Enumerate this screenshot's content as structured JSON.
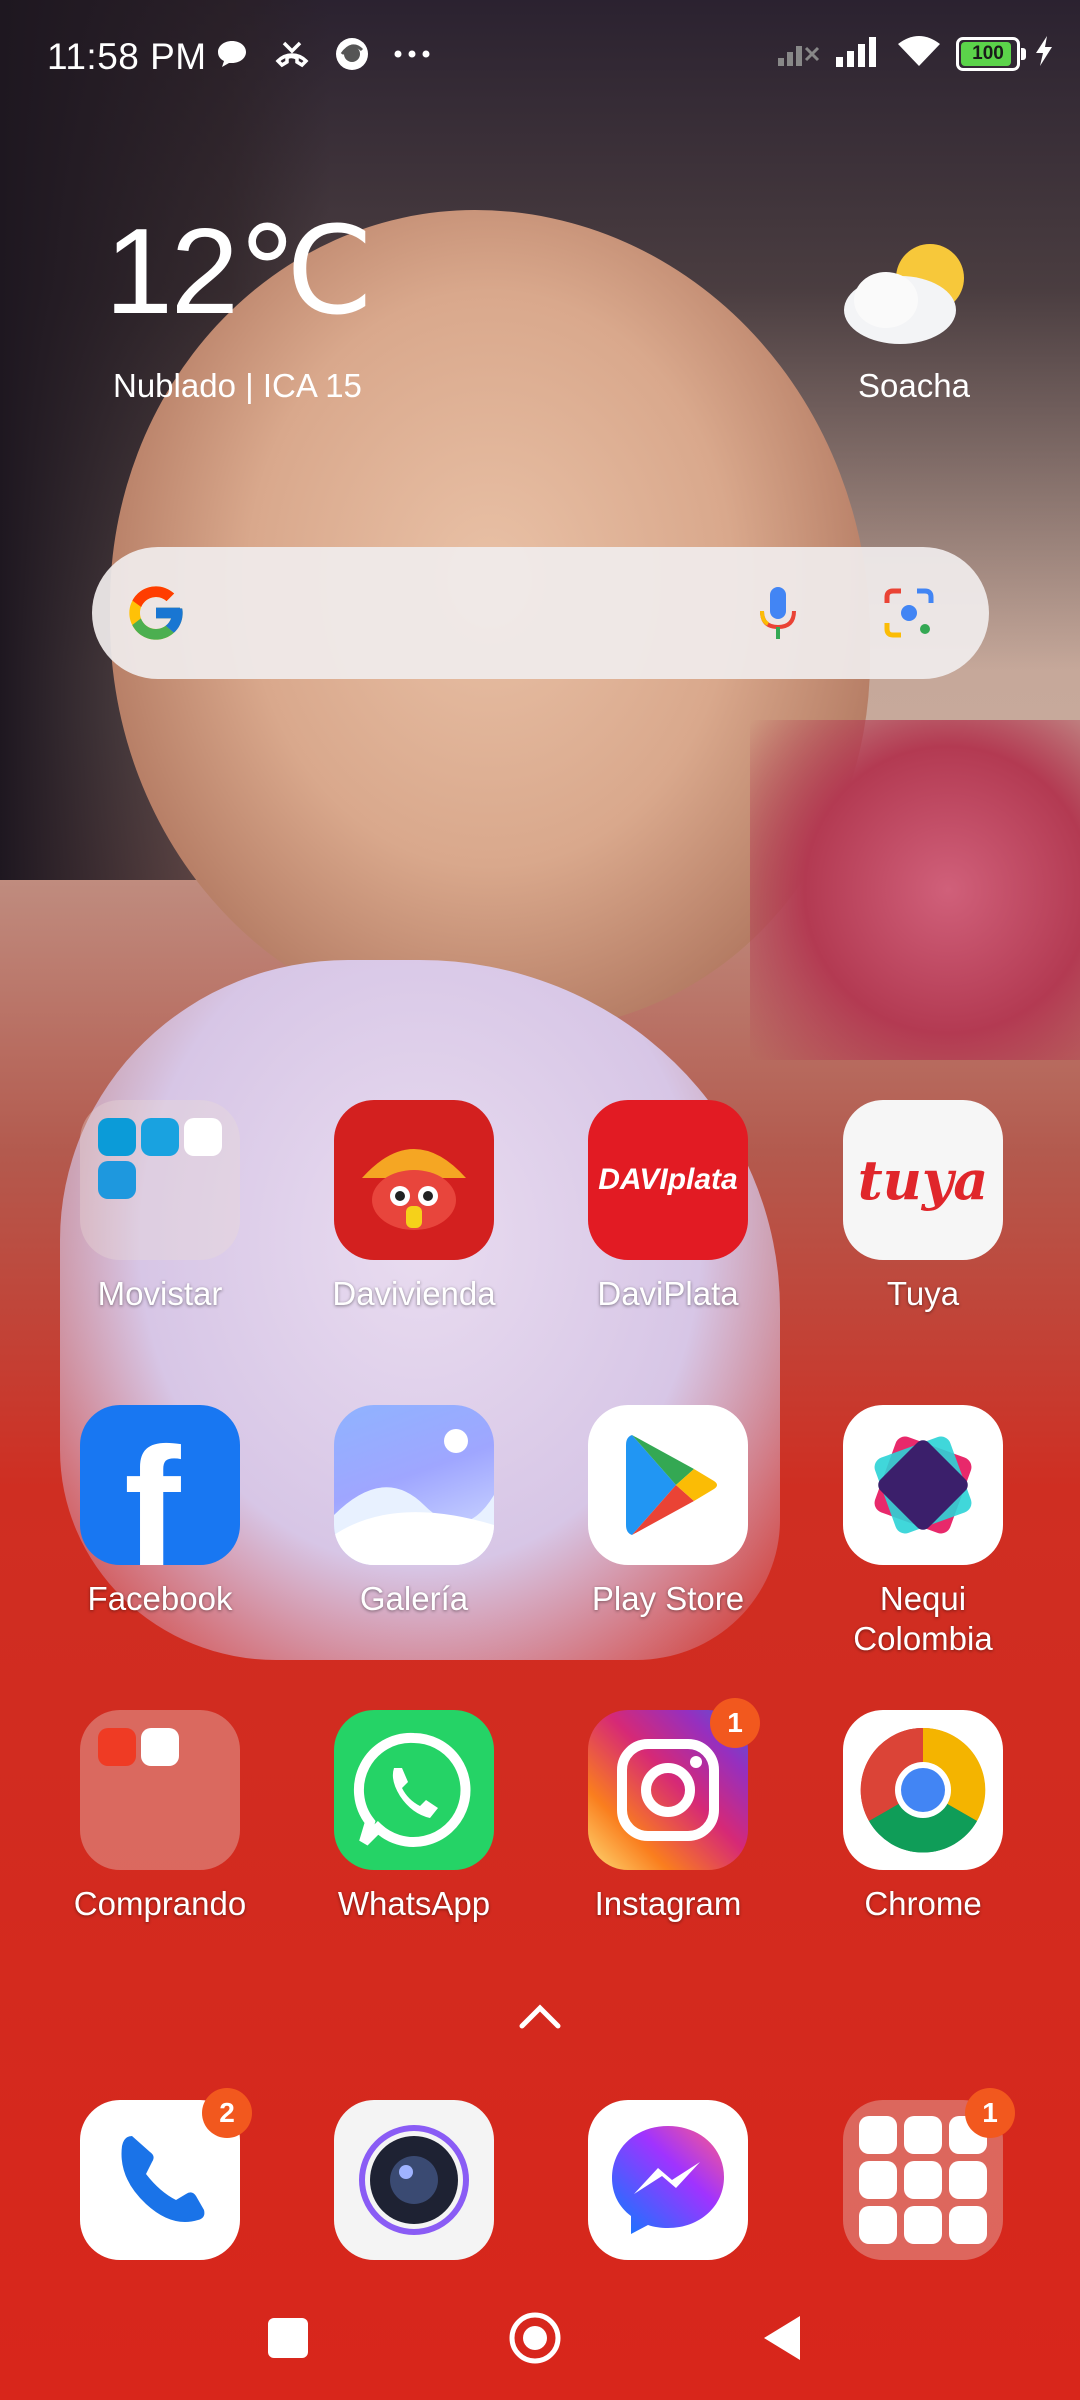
{
  "status_bar": {
    "time": "11:58 PM",
    "battery": "100",
    "battery_level": 1.0,
    "icons_left": [
      "chat-bubble-icon",
      "missed-call-icon",
      "app-notification-icon",
      "more-dots-icon"
    ],
    "icons_right": [
      "no-signal-icon",
      "signal-icon",
      "wifi-icon",
      "battery-icon",
      "charging-icon"
    ]
  },
  "weather": {
    "temperature": "12℃",
    "description": "Nublado | ICA 15",
    "city": "Soacha",
    "icon": "partly-cloudy-icon"
  },
  "search": {
    "icons": [
      "google-logo",
      "mic-icon",
      "lens-icon"
    ]
  },
  "apps": {
    "row1": [
      {
        "label": "Movistar",
        "type": "folder"
      },
      {
        "label": "Davivienda"
      },
      {
        "label": "DaviPlata",
        "icon_text": "DAVIplata"
      },
      {
        "label": "Tuya",
        "icon_text": "tuya"
      }
    ],
    "row2": [
      {
        "label": "Facebook",
        "icon_text": "f"
      },
      {
        "label": "Galería"
      },
      {
        "label": "Play Store"
      },
      {
        "label": "Nequi\nColombia",
        "label_line1": "Nequi",
        "label_line2": "Colombia"
      }
    ],
    "row3": [
      {
        "label": "Comprando",
        "type": "folder"
      },
      {
        "label": "WhatsApp"
      },
      {
        "label": "Instagram",
        "badge": "1"
      },
      {
        "label": "Chrome"
      }
    ]
  },
  "dock": {
    "phone_badge": "2",
    "google_folder_badge": "1"
  },
  "colors": {
    "badge": "#f2581e",
    "facebook": "#1877f2",
    "whatsapp": "#25d366",
    "davivienda": "#d3201f"
  }
}
